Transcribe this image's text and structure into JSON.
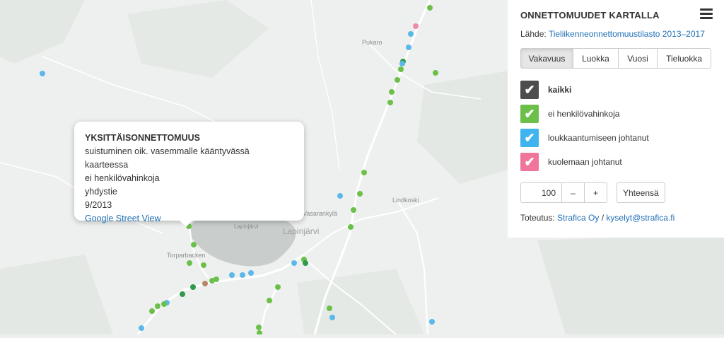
{
  "map": {
    "places": {
      "pukaro": "Pukaro",
      "lindkoski": "Lindkoski",
      "vasarankyla": "Vasarankylä",
      "lapinjarvi_lake": "Lapinjärvi",
      "lapinjarvi_town": "Lapinjärvi",
      "torparbacken": "Torparbacken"
    },
    "colors": {
      "green": "#6cc04a",
      "darkgreen": "#2e9a4a",
      "blue": "#5ab8ea",
      "pink": "#f08aab",
      "brown": "#b8866a"
    }
  },
  "popup": {
    "type": "YKSITTÄISONNETTOMUUS",
    "description": "suistuminen oik. vasemmalle kääntyvässä kaarteessa",
    "severity": "ei henkilövahinkoja",
    "road": "yhdystie",
    "date": "9/2013",
    "link": "Google Street View"
  },
  "panel": {
    "title": "ONNETTOMUUDET KARTALLA",
    "source_prefix": "Lähde: ",
    "source_link": "Tieliikenneonnettomuustilasto 2013–2017",
    "tabs": [
      "Vakavuus",
      "Luokka",
      "Vuosi",
      "Tieluokka"
    ],
    "legend": [
      {
        "label": "kaikki",
        "color": "#4d4d4d"
      },
      {
        "label": "ei henkilövahinkoja",
        "color": "#6cc04a"
      },
      {
        "label": "loukkaantumiseen johtanut",
        "color": "#3fb4ee"
      },
      {
        "label": "kuolemaan johtanut",
        "color": "#f0759a"
      }
    ],
    "count_value": "100",
    "minus": "–",
    "plus": "+",
    "total_button": "Yhteensä",
    "credits_prefix": "Toteutus: ",
    "credits_company": "Strafica Oy",
    "credits_sep": " / ",
    "credits_email": "kyselyt@strafica.fi"
  }
}
